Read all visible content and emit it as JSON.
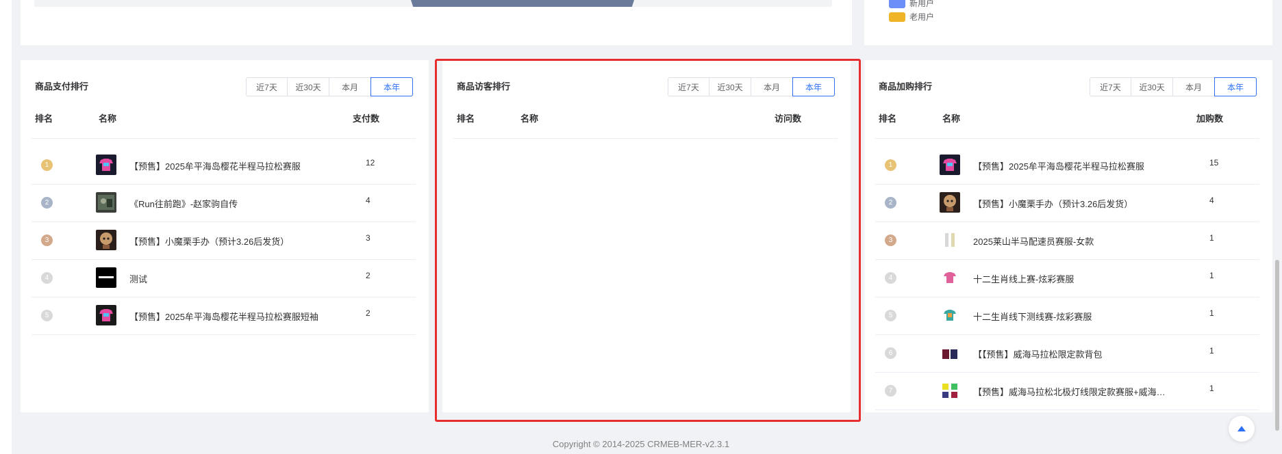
{
  "legend": [
    {
      "label": "新用户",
      "color": "#6c8ef7"
    },
    {
      "label": "老用户",
      "color": "#f0b429"
    }
  ],
  "filters": [
    "近7天",
    "近30天",
    "本月",
    "本年"
  ],
  "active_filter": "本年",
  "cards": [
    {
      "title": "商品支付排行",
      "columns": {
        "rank": "排名",
        "name": "名称",
        "value": "支付数"
      },
      "rows": [
        {
          "rank": "1",
          "name": "【预售】2025牟平海岛樱花半程马拉松赛服",
          "value": "12",
          "thumb": "jersey-icon"
        },
        {
          "rank": "2",
          "name": "《Run往前跑》-赵家驹自传",
          "value": "4",
          "thumb": "book-photo-icon"
        },
        {
          "rank": "3",
          "name": "【预售】小魔栗手办（预计3.26后发货）",
          "value": "3",
          "thumb": "figure-icon"
        },
        {
          "rank": "4",
          "name": "测试",
          "value": "2",
          "thumb": "test-icon"
        },
        {
          "rank": "5",
          "name": "【预售】2025牟平海岛樱花半程马拉松赛服短袖",
          "value": "2",
          "thumb": "tshirt-icon"
        }
      ]
    },
    {
      "title": "商品访客排行",
      "columns": {
        "rank": "排名",
        "name": "名称",
        "value": "访问数"
      },
      "rows": []
    },
    {
      "title": "商品加购排行",
      "columns": {
        "rank": "排名",
        "name": "名称",
        "value": "加购数"
      },
      "rows": [
        {
          "rank": "1",
          "name": "【预售】2025牟平海岛樱花半程马拉松赛服",
          "value": "15",
          "thumb": "jersey-icon"
        },
        {
          "rank": "2",
          "name": "【预售】小魔栗手办（预计3.26后发货）",
          "value": "4",
          "thumb": "figure-icon"
        },
        {
          "rank": "3",
          "name": "2025莱山半马配速员赛服-女款",
          "value": "1",
          "thumb": "pacer-outfit-icon"
        },
        {
          "rank": "4",
          "name": "十二生肖线上赛-炫彩赛服",
          "value": "1",
          "thumb": "pink-shirt-icon"
        },
        {
          "rank": "5",
          "name": "十二生肖线下测线赛-炫彩赛服",
          "value": "1",
          "thumb": "color-shirt-icon"
        },
        {
          "rank": "6",
          "name": "【【预售】威海马拉松限定款背包",
          "value": "1",
          "thumb": "backpack-icon"
        },
        {
          "rank": "7",
          "name": "【预售】威海马拉松北极灯线限定款赛服+威海…",
          "value": "1",
          "thumb": "shirt-set-icon"
        }
      ]
    }
  ],
  "rank_colors": [
    "#e8c275",
    "#a8b4c8",
    "#d3a98c",
    "#d9d9d9",
    "#d9d9d9",
    "#d9d9d9",
    "#d9d9d9"
  ],
  "footer": "Copyright © 2014-2025 CRMEB-MER-v2.3.1"
}
